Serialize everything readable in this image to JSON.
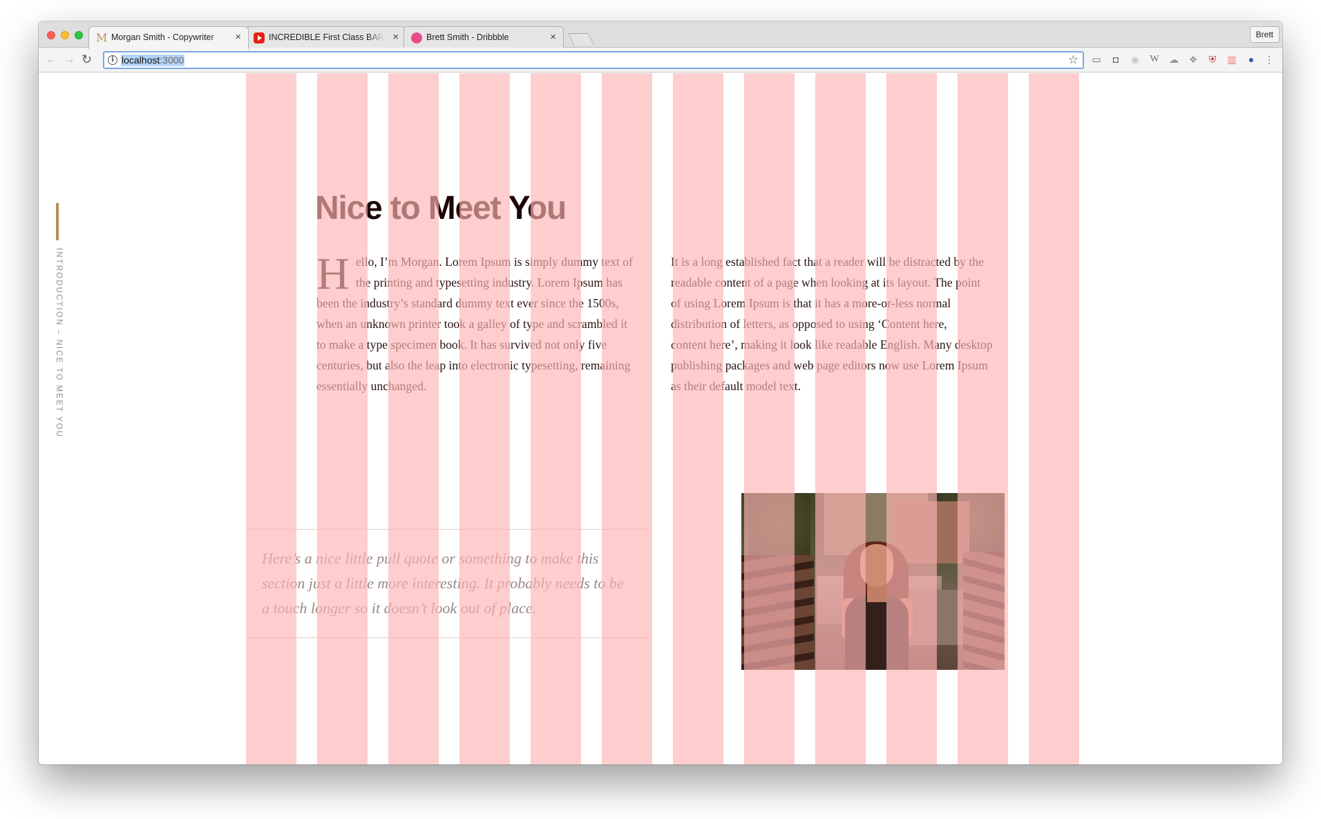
{
  "browser": {
    "tabs": [
      {
        "title": "Morgan Smith - Copywriter",
        "favicon": "m-logo-icon"
      },
      {
        "title": "INCREDIBLE First Class BAR A",
        "favicon": "youtube-icon"
      },
      {
        "title": "Brett Smith - Dribbble",
        "favicon": "dribbble-icon"
      }
    ],
    "tab_close": "×",
    "profile_name": "Brett",
    "url_host": "localhost",
    "url_port": ":3000"
  },
  "page": {
    "side_label": "INTRODUCTION – NICE TO MEET YOU",
    "heading": "Nice to Meet You",
    "dropcap": "H",
    "left_first_lines": "ello, I’m Morgan. Lorem Ipsum is simply dummy text of\nthe printing and typesetting industry. Lorem Ipsum has",
    "left_rest": "been the industry’s standard dummy text ever since the 1500s,\nwhen an unknown printer took a galley of type and scrambled it\nto make a type specimen book. It has survived not only five\ncenturies, but also the leap into electronic typesetting, remaining\nessentially unchanged.",
    "right_paragraph": "It is a long established fact that a reader will be distracted by the\nreadable content of a page when looking at its layout. The point\nof using Lorem Ipsum is that it has a more-or-less normal\ndistribution of letters, as opposed to using ‘Content here,\ncontent here’, making it look like readable English. Many desktop\npublishing packages and web page editors now use Lorem Ipsum\nas their default model text.",
    "pull_quote": "Here’s a nice little pull quote or something to make this\nsection just a little more interesting. It probably needs to be\na touch longer so it doesn’t look out of place."
  },
  "colors": {
    "accent_gold": "#b59255",
    "grid_overlay": "#fdb3b3",
    "heading": "#1c0505"
  }
}
